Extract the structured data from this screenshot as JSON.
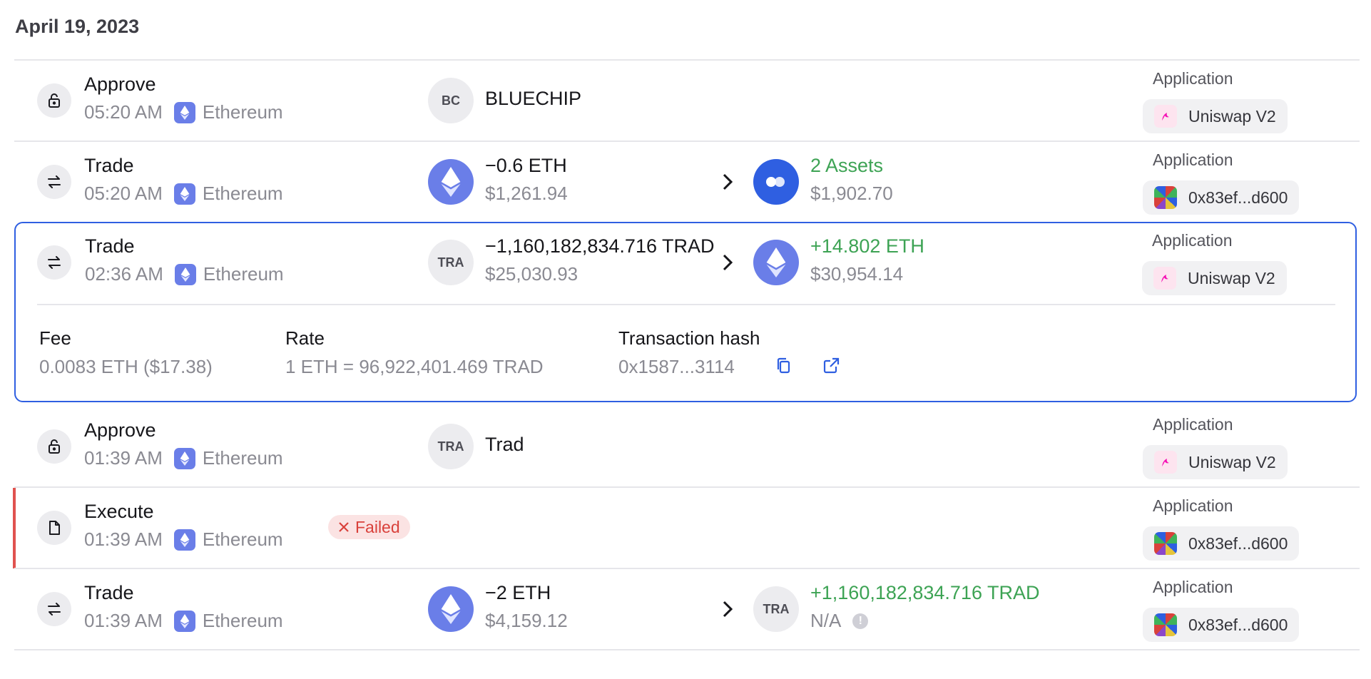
{
  "date_header": "April 19, 2023",
  "rows": [
    {
      "type": "Approve",
      "time": "05:20 AM",
      "chain": "Ethereum",
      "token_abbr": "BC",
      "token_name": "BLUECHIP",
      "app_label": "Application",
      "app_name": "Uniswap V2"
    },
    {
      "type": "Trade",
      "time": "05:20 AM",
      "chain": "Ethereum",
      "out_amount": "−0.6 ETH",
      "out_value": "$1,261.94",
      "in_amount": "2 Assets",
      "in_value": "$1,902.70",
      "app_label": "Application",
      "app_name": "0x83ef...d600"
    },
    {
      "type": "Trade",
      "time": "02:36 AM",
      "chain": "Ethereum",
      "out_token_abbr": "TRA",
      "out_amount": "−1,160,182,834.716 TRAD",
      "out_value": "$25,030.93",
      "in_amount": "+14.802 ETH",
      "in_value": "$30,954.14",
      "app_label": "Application",
      "app_name": "Uniswap V2",
      "details": {
        "fee_label": "Fee",
        "fee_value": "0.0083 ETH ($17.38)",
        "rate_label": "Rate",
        "rate_value": "1 ETH = 96,922,401.469 TRAD",
        "hash_label": "Transaction hash",
        "hash_value": "0x1587...3114"
      }
    },
    {
      "type": "Approve",
      "time": "01:39 AM",
      "chain": "Ethereum",
      "token_abbr": "TRA",
      "token_name": "Trad",
      "app_label": "Application",
      "app_name": "Uniswap V2"
    },
    {
      "type": "Execute",
      "time": "01:39 AM",
      "chain": "Ethereum",
      "status": "Failed",
      "app_label": "Application",
      "app_name": "0x83ef...d600"
    },
    {
      "type": "Trade",
      "time": "01:39 AM",
      "chain": "Ethereum",
      "out_amount": "−2 ETH",
      "out_value": "$4,159.12",
      "in_token_abbr": "TRA",
      "in_amount": "+1,160,182,834.716 TRAD",
      "in_value": "N/A",
      "app_label": "Application",
      "app_name": "0x83ef...d600"
    }
  ],
  "colors": {
    "accent_blue": "#2f5fe1",
    "positive_green": "#3da354",
    "failed_red": "#d9413b",
    "eth_purple": "#6a7ee8"
  },
  "icons": {
    "approve": "lock-icon",
    "trade": "swap-arrows-icon",
    "execute": "document-icon",
    "chain": "ethereum-icon",
    "copy": "copy-icon",
    "external": "external-link-icon",
    "info": "exclamation-icon",
    "failed": "x-icon"
  }
}
